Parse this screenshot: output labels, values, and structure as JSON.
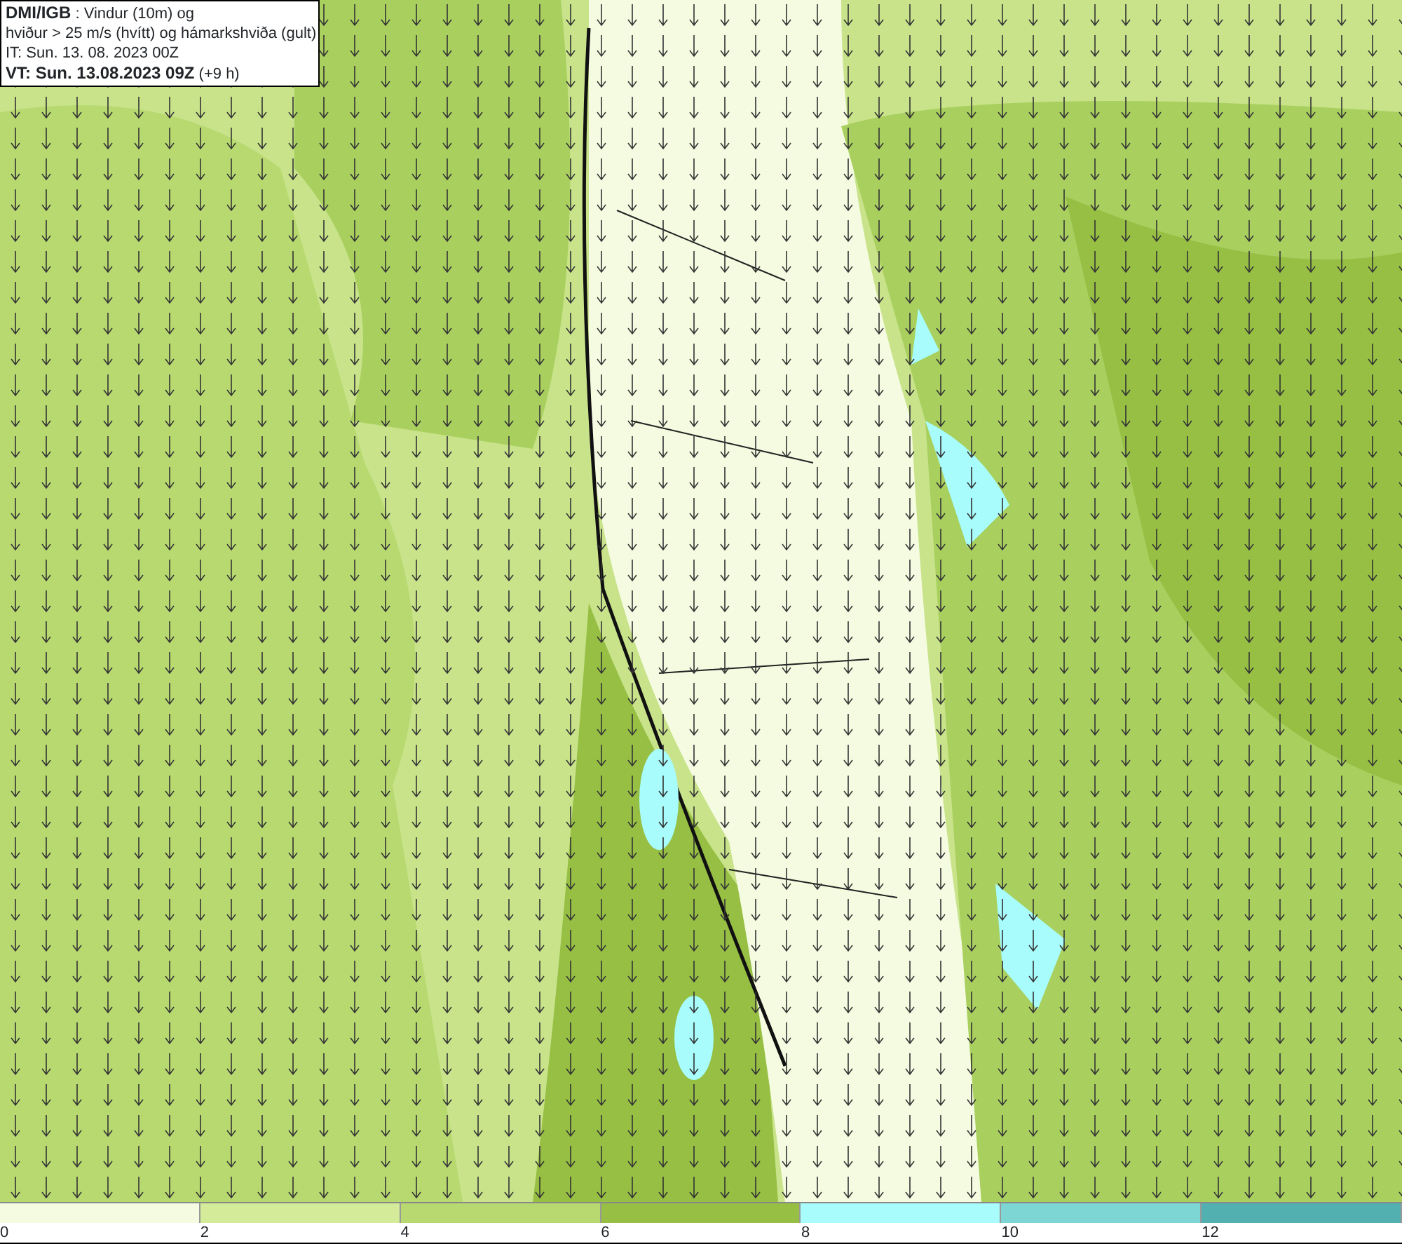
{
  "title_box": {
    "lines": [
      "**DMI/IGB** : Vindur (10m) og",
      "hviður > 25 m/s (hvítt) og hámarkshviða (gult)",
      "IT: Sun. 13. 08. 2023 00Z",
      "**VT: Sun. 13.08.2023 09Z** (+9 h)"
    ]
  },
  "legend": [
    {
      "label": "0",
      "color": "#f5fbe0"
    },
    {
      "label": "2",
      "color": "#d4eb9a"
    },
    {
      "label": "4",
      "color": "#b7d970"
    },
    {
      "label": "6",
      "color": "#96bf44"
    },
    {
      "label": "8",
      "color": "#a8fcfc"
    },
    {
      "label": "10",
      "color": "#7ed6d4"
    },
    {
      "label": "12",
      "color": "#52b0b0"
    }
  ]
}
